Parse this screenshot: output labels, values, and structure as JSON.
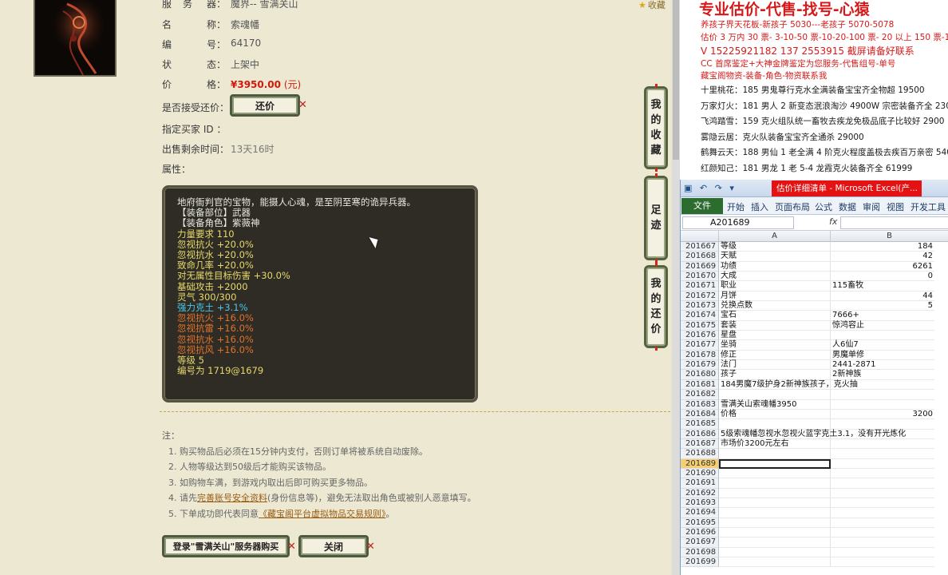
{
  "item": {
    "server_label_1": "服",
    "server_label_2": "务",
    "server_label_3": "器：",
    "server_value": "魔界-- 雪满关山",
    "name_label_1": "名",
    "name_label_2": "称：",
    "name_value": "索魂幡",
    "id_label_1": "编",
    "id_label_2": "号：",
    "id_value": "64170",
    "status_label_1": "状",
    "status_label_2": "态：",
    "status_value": "上架中",
    "price_label_1": "价",
    "price_label_2": "格：",
    "price_value": "¥3950.00",
    "price_unit": "(元)",
    "bargain_label": "是否接受还价：",
    "bargain_button": "还价",
    "buyer_label": "指定买家 ID ：",
    "remaining_label": "出售剩余时间：",
    "remaining_value": "13天16时",
    "attr_label": "属性："
  },
  "fav_link": "收藏",
  "description": [
    {
      "text": "地府衙判官的宝物，能摄人心魂，是至阴至寒的诡异兵器。",
      "color": "#e8e8e0"
    },
    {
      "text": "【装备部位】武器",
      "color": "#e8e8e0"
    },
    {
      "text": "【装备角色】紫薇神",
      "color": "#e8e8e0"
    },
    {
      "text": "力量要求 110",
      "color": "#e8d96a"
    },
    {
      "text": "忽视抗火 +20.0%",
      "color": "#e8d96a"
    },
    {
      "text": "忽视抗水 +20.0%",
      "color": "#e8d96a"
    },
    {
      "text": "致命几率 +20.0%",
      "color": "#e8d96a"
    },
    {
      "text": "对无属性目标伤害 +30.0%",
      "color": "#e8d96a"
    },
    {
      "text": "基础攻击 +2000",
      "color": "#e8d96a"
    },
    {
      "text": "灵气 300/300",
      "color": "#e8d96a"
    },
    {
      "text": "强力克土 +3.1%",
      "color": "#49c8ea"
    },
    {
      "text": "忽视抗火 +16.0%",
      "color": "#e0732c"
    },
    {
      "text": "忽视抗雷 +16.0%",
      "color": "#e0732c"
    },
    {
      "text": "忽视抗水 +16.0%",
      "color": "#e0732c"
    },
    {
      "text": "忽视抗风 +16.0%",
      "color": "#e0732c"
    },
    {
      "text": "等级 5",
      "color": "#e8d96a"
    },
    {
      "text": "编号为 1719@1679",
      "color": "#e8d96a"
    }
  ],
  "side_buttons": [
    {
      "label": "我的收藏",
      "chars": [
        "我",
        "的",
        "收",
        "藏"
      ]
    },
    {
      "label": "足迹",
      "chars": [
        "足",
        "迹"
      ]
    },
    {
      "label": "我的还价",
      "chars": [
        "我",
        "的",
        "还",
        "价"
      ]
    }
  ],
  "notes": {
    "title": "注：",
    "line1": "1. 购买物品后必须在15分钟内支付，否则订单将被系统自动废除。",
    "line2": "2. 人物等级达到50级后才能购买该物品。",
    "line3": "3. 如购物车满，到游戏内取出后即可购买更多物品。",
    "line4_pre": "4. 请先",
    "line4_link": "完善账号安全资料",
    "line4_post": "(身份信息等)，避免无法取出角色或被别人恶意填写。",
    "line5_pre": "5. 下单成功即代表同意",
    "line5_link": "《藏宝阁平台虚拟物品交易规则》",
    "line5_post": "。"
  },
  "buttons": {
    "login_buy": "登录\"雪满关山\"服务器购买",
    "close": "关闭"
  },
  "doc": {
    "big_title": "专业估价-代售-找号-心猿",
    "line1": "养孩子界天花板-新孩子 5030---老孩子 5070-5078",
    "line2": "估价 3 万内 30 票- 3-10-50 票-10-20-100 票- 20 以上 150 票-1 票 1",
    "line3": "V 15225921182     137 2553915    截屏请备好联系",
    "line4": "CC 首席鉴定+大神金牌鉴定为您服务-代售组号-单号",
    "line5": "藏宝阁物资-装备-角色-物资联系我",
    "listings": [
      "十里桃花：185 男鬼尊行克水全满装备宝宝齐全物超 19500",
      "万家灯火：181 男人 2 新变态泯浪淘沙 4900W 宗密装备齐全 2300",
      "飞鸿踏雪：159 克火组队统一畜牧去疾龙免极品底子比较好 2900",
      "雾隐云居：克火队装备宝宝齐全通杀 29000",
      "鹤舞云天：188 男仙 1 老全满 4 阶克火程度盖极去疾百万亲密 540",
      "红颜知己：181 男龙 1 老 5-4 龙霞克火装备齐全 61999"
    ]
  },
  "excel": {
    "quick_access": "▣ ↶ ↷ ▾",
    "title": "估价详细清单 - Microsoft Excel(产...",
    "file_tab": "文件",
    "tabs": [
      "开始",
      "插入",
      "页面布局",
      "公式",
      "数据",
      "审阅",
      "视图",
      "开发工具"
    ],
    "name_box": "A201689",
    "fx": "fx",
    "col_a": "A",
    "col_b": "B",
    "rows": [
      {
        "n": "201667",
        "a": "等级",
        "b": "184",
        "num": true
      },
      {
        "n": "201668",
        "a": "天赋",
        "b": "42",
        "num": true
      },
      {
        "n": "201669",
        "a": "功绩",
        "b": "6261",
        "num": true
      },
      {
        "n": "201670",
        "a": "大成",
        "b": "0",
        "num": true
      },
      {
        "n": "201671",
        "a": "职业",
        "b": "115畜牧",
        "num": false
      },
      {
        "n": "201672",
        "a": "月饼",
        "b": "44",
        "num": true
      },
      {
        "n": "201673",
        "a": "兑换点数",
        "b": "5",
        "num": true
      },
      {
        "n": "201674",
        "a": "宝石",
        "b": "7666+",
        "num": false
      },
      {
        "n": "201675",
        "a": "套装",
        "b": "惊鸿容止",
        "num": false
      },
      {
        "n": "201676",
        "a": "星盘",
        "b": "",
        "num": false
      },
      {
        "n": "201677",
        "a": "坐骑",
        "b": "人6仙7",
        "num": false
      },
      {
        "n": "201678",
        "a": "修正",
        "b": "男魔单修",
        "num": false
      },
      {
        "n": "201679",
        "a": "法门",
        "b": "2441-2871",
        "num": false
      },
      {
        "n": "201680",
        "a": "孩子",
        "b": "2新神族",
        "num": false
      },
      {
        "n": "201681",
        "a": "184男魔7级护身2新神族孩子，克火抽",
        "b": "",
        "num": false
      },
      {
        "n": "201682",
        "a": "",
        "b": "",
        "num": false
      },
      {
        "n": "201683",
        "a": "雪满关山索魂幡3950",
        "b": "",
        "num": false
      },
      {
        "n": "201684",
        "a": "价格",
        "b": "3200",
        "num": true
      },
      {
        "n": "201685",
        "a": "",
        "b": "",
        "num": false
      },
      {
        "n": "201686",
        "a": "5级索魂幡忽视水忽视火蓝字克土3.1，没有开光炼化",
        "b": "",
        "num": false
      },
      {
        "n": "201687",
        "a": "市场价3200元左右",
        "b": "",
        "num": false
      },
      {
        "n": "201688",
        "a": "",
        "b": "",
        "num": false
      },
      {
        "n": "201689",
        "a": "",
        "b": "",
        "num": false,
        "selected": true
      },
      {
        "n": "201690",
        "a": "",
        "b": "",
        "num": false
      },
      {
        "n": "201691",
        "a": "",
        "b": "",
        "num": false
      },
      {
        "n": "201692",
        "a": "",
        "b": "",
        "num": false
      },
      {
        "n": "201693",
        "a": "",
        "b": "",
        "num": false
      },
      {
        "n": "201694",
        "a": "",
        "b": "",
        "num": false
      },
      {
        "n": "201695",
        "a": "",
        "b": "",
        "num": false
      },
      {
        "n": "201696",
        "a": "",
        "b": "",
        "num": false
      },
      {
        "n": "201697",
        "a": "",
        "b": "",
        "num": false
      },
      {
        "n": "201698",
        "a": "",
        "b": "",
        "num": false
      },
      {
        "n": "201699",
        "a": "",
        "b": "",
        "num": false
      }
    ]
  },
  "colors": {
    "price_red": "#d01a0a",
    "doc_red": "#d61a1a",
    "excel_green": "#2c6c2e",
    "chain_red": "#c72b1d"
  }
}
